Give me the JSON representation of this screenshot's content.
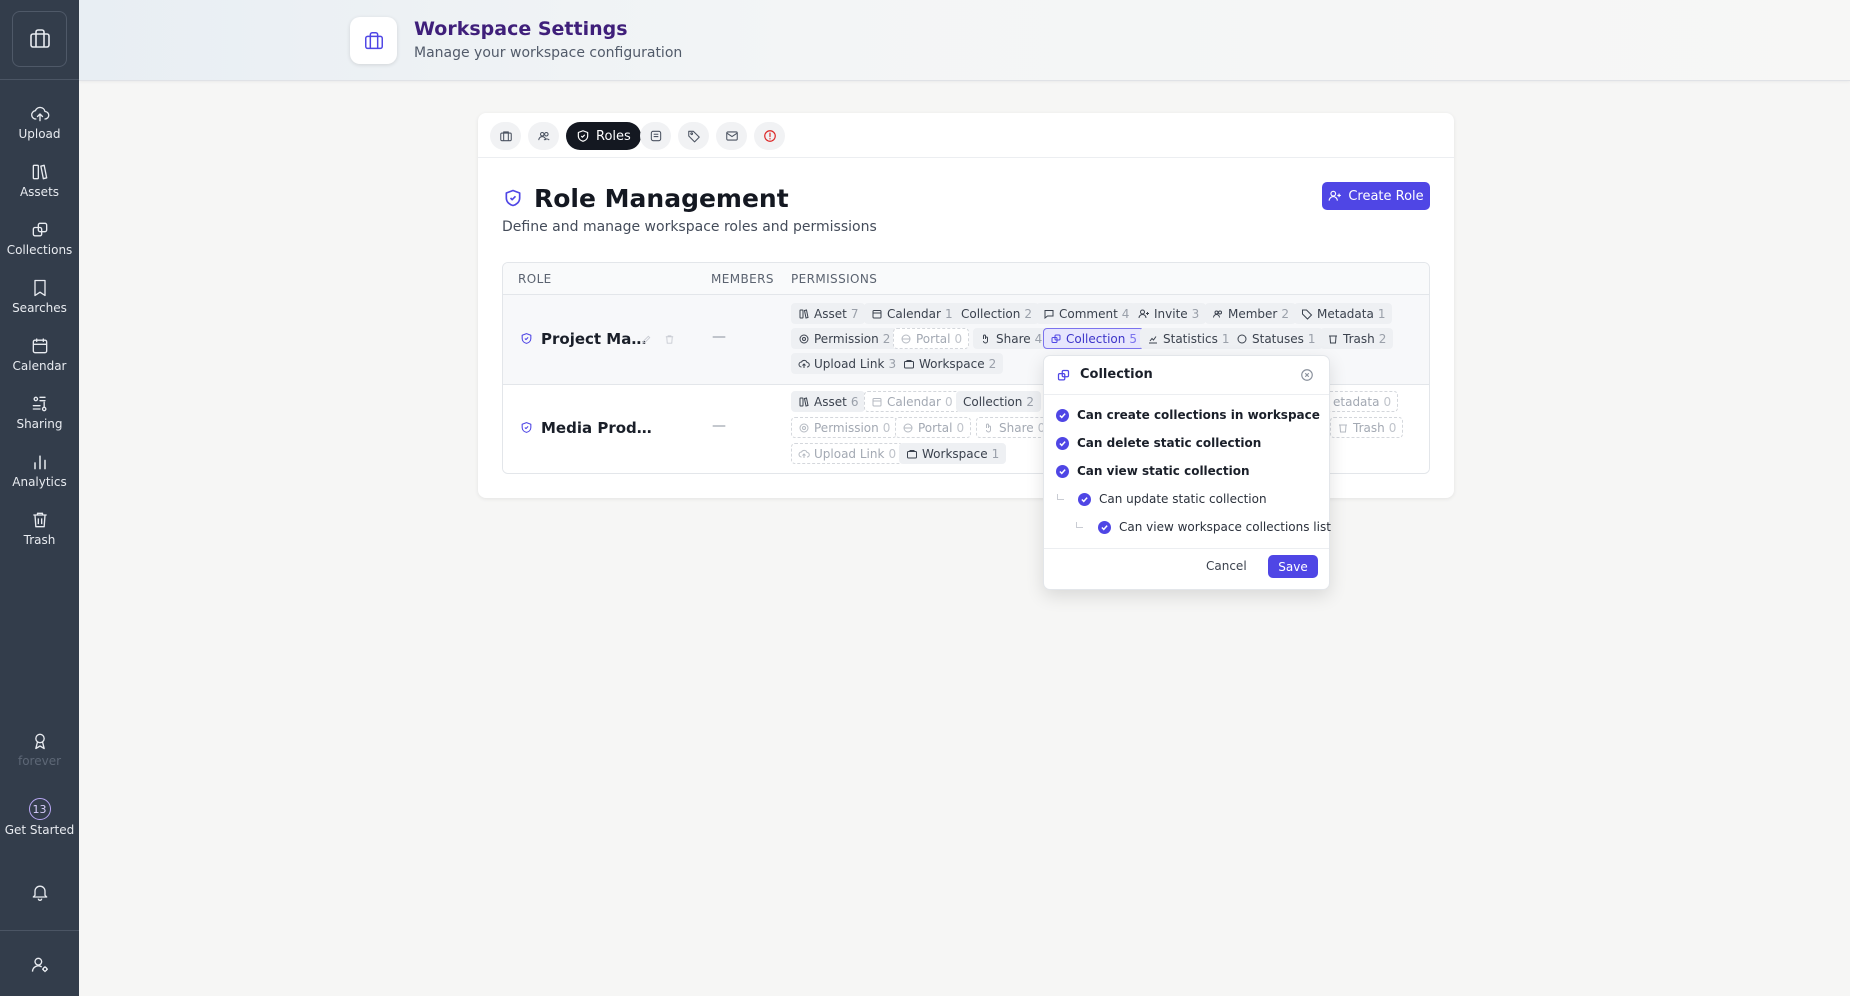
{
  "sidebar": {
    "items": [
      {
        "label": "Upload",
        "icon": "upload-icon"
      },
      {
        "label": "Assets",
        "icon": "assets-icon"
      },
      {
        "label": "Collections",
        "icon": "collections-icon"
      },
      {
        "label": "Searches",
        "icon": "bookmark-icon"
      },
      {
        "label": "Calendar",
        "icon": "calendar-icon"
      },
      {
        "label": "Sharing",
        "icon": "sharing-icon"
      },
      {
        "label": "Analytics",
        "icon": "analytics-icon"
      },
      {
        "label": "Trash",
        "icon": "trash-icon"
      }
    ],
    "plan": {
      "label": "forever",
      "icon": "award-icon"
    },
    "get_started": {
      "label": "Get Started",
      "count": "13"
    }
  },
  "header": {
    "title": "Workspace Settings",
    "subtitle": "Manage your workspace configuration"
  },
  "tabs": {
    "active_label": "Roles"
  },
  "roles_section": {
    "title": "Role Management",
    "description": "Define and manage workspace roles and permissions",
    "create_button": "Create Role",
    "columns": {
      "role": "ROLE",
      "members": "MEMBERS",
      "permissions": "PERMISSIONS"
    },
    "rows": [
      {
        "name": "Project Ma…",
        "members": "—",
        "chips": [
          {
            "label": "Asset",
            "count": "7"
          },
          {
            "label": "Calendar",
            "count": "1"
          },
          {
            "label": "Collection",
            "count": "2"
          },
          {
            "label": "Comment",
            "count": "4"
          },
          {
            "label": "Invite",
            "count": "3"
          },
          {
            "label": "Member",
            "count": "2"
          },
          {
            "label": "Metadata",
            "count": "1"
          },
          {
            "label": "Permission",
            "count": "2"
          },
          {
            "label": "Portal",
            "count": "0"
          },
          {
            "label": "Share",
            "count": "4"
          },
          {
            "label": "Collection",
            "count": "5"
          },
          {
            "label": "Statistics",
            "count": "1"
          },
          {
            "label": "Statuses",
            "count": "1"
          },
          {
            "label": "Trash",
            "count": "2"
          },
          {
            "label": "Upload Link",
            "count": "3"
          },
          {
            "label": "Workspace",
            "count": "2"
          }
        ]
      },
      {
        "name": "Media Prod…",
        "members": "—",
        "chips": [
          {
            "label": "Asset",
            "count": "6"
          },
          {
            "label": "Calendar",
            "count": "0"
          },
          {
            "label": "Collection",
            "count": "2"
          },
          {
            "label": "etadata",
            "count": "0"
          },
          {
            "label": "Permission",
            "count": "0"
          },
          {
            "label": "Portal",
            "count": "0"
          },
          {
            "label": "Share",
            "count": "0"
          },
          {
            "label": "Trash",
            "count": "0"
          },
          {
            "label": "Upload Link",
            "count": "0"
          },
          {
            "label": "Workspace",
            "count": "1"
          }
        ]
      }
    ]
  },
  "popover": {
    "title": "Collection",
    "permissions": [
      "Can create collections in workspace",
      "Can delete static collection",
      "Can view static collection",
      "Can update static collection",
      "Can view workspace collections list"
    ],
    "cancel": "Cancel",
    "save": "Save"
  },
  "colors": {
    "sidebar_bg": "#333d4b",
    "accent": "#4f46e5",
    "title_purple": "#3f1f7a",
    "danger": "#dc2626"
  }
}
